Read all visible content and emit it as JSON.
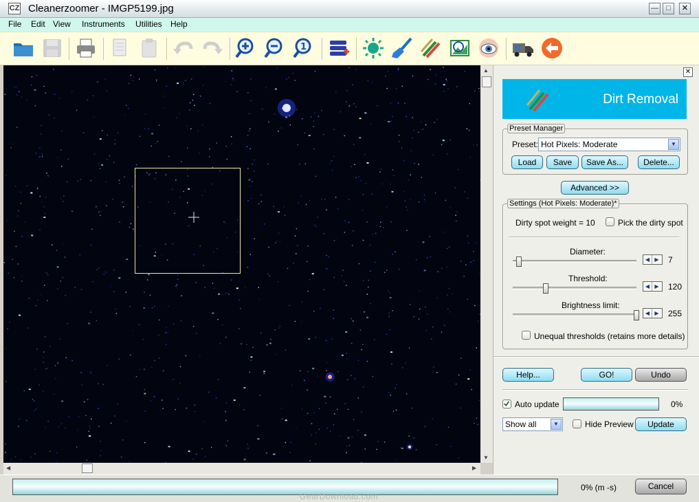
{
  "window": {
    "title": "Cleanerzoomer - IMGP5199.jpg",
    "app_icon_text": "CZ"
  },
  "menu": {
    "items": [
      "File",
      "Edit",
      "View",
      "Instruments",
      "Utilities",
      "Help"
    ]
  },
  "toolbar": {
    "buttons": [
      "open-icon",
      "save-icon",
      "print-icon",
      "copy-icon",
      "paste-icon",
      "undo-icon",
      "redo-icon",
      "zoom-in-icon",
      "zoom-out-icon",
      "zoom-actual-icon",
      "layers-add-icon",
      "brightness-icon",
      "broom-icon",
      "brushes-icon",
      "preview-image-icon",
      "eye-icon",
      "truck-icon",
      "back-arrow-icon"
    ]
  },
  "panel": {
    "banner_title": "Dirt Removal",
    "preset_manager": {
      "title": "Preset Manager",
      "preset_label": "Preset:",
      "preset_value": "Hot Pixels: Moderate",
      "buttons": {
        "load": "Load",
        "save": "Save",
        "save_as": "Save As...",
        "delete": "Delete..."
      }
    },
    "advanced_button": "Advanced >>",
    "settings": {
      "title": "Settings (Hot Pixels: Moderate)*",
      "dirty_spot_weight": "Dirty spot weight = 10",
      "pick_dirty_spot": "Pick the dirty spot",
      "pick_dirty_spot_checked": false,
      "diameter": {
        "label": "Diameter:",
        "value": "7",
        "level": 0.03
      },
      "threshold": {
        "label": "Threshold:",
        "value": "120",
        "level": 0.25
      },
      "brightness_limit": {
        "label": "Brightness limit:",
        "value": "255",
        "level": 1.0
      },
      "unequal_thresholds": "Unequal thresholds (retains more details)",
      "unequal_thresholds_checked": false
    },
    "actions": {
      "help": "Help...",
      "go": "GO!",
      "undo": "Undo"
    },
    "auto_update": {
      "label": "Auto update",
      "checked": true,
      "progress_text": "0%",
      "progress": 0
    },
    "show_select": "Show all",
    "hide_preview": {
      "label": "Hide Preview",
      "checked": false
    },
    "update_button": "Update"
  },
  "statusbar": {
    "progress": 0,
    "status_text": "0% (m -s)",
    "cancel_label": "Cancel",
    "watermark": "GearDownload.com"
  },
  "colors": {
    "menubar_bg": "#d0f7ec",
    "toolbar_bg": "#fffde0",
    "banner_bg": "#00b6e8",
    "canvas_bg": "#020410"
  }
}
